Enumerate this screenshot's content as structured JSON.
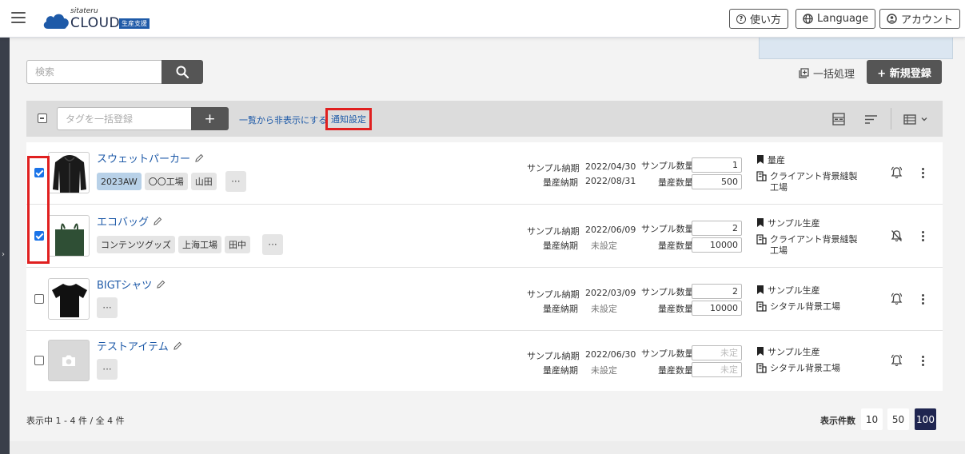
{
  "header": {
    "logo_sub": "sitateru",
    "logo_main": "CLOUD",
    "logo_badge": "生産支援",
    "help_label": "使い方",
    "language_label": "Language",
    "account_label": "アカウント"
  },
  "search": {
    "placeholder": "検索"
  },
  "actions": {
    "bulk_label": "一括処理",
    "new_label": "+ 新規登録"
  },
  "toolbar": {
    "tag_placeholder": "タグを一括登録",
    "tag_add": "+",
    "hide_label": "一覧から非表示にする",
    "notify_label": "通知設定"
  },
  "labels": {
    "sample_due": "サンプル納期",
    "mass_due": "量産納期",
    "sample_qty": "サンプル数量",
    "mass_qty": "量産数量"
  },
  "items": [
    {
      "name": "スウェットパーカー",
      "checked": true,
      "tags": [
        "2023AW",
        "〇〇工場",
        "山田"
      ],
      "sample_date": "2022/04/30",
      "mass_date": "2022/08/31",
      "sample_qty": "1",
      "mass_qty": "500",
      "status": "量産",
      "factory": "クライアント背景縫製工場",
      "bell": "on",
      "image": "hoodie"
    },
    {
      "name": "エコバッグ",
      "checked": true,
      "tags": [
        "コンテンツグッズ",
        "上海工場",
        "田中"
      ],
      "sample_date": "2022/06/09",
      "mass_date": "未設定",
      "sample_qty": "2",
      "mass_qty": "10000",
      "status": "サンプル生産",
      "factory": "クライアント背景縫製工場",
      "bell": "off",
      "image": "bag"
    },
    {
      "name": "BIGTシャツ",
      "checked": false,
      "tags": [],
      "sample_date": "2022/03/09",
      "mass_date": "未設定",
      "sample_qty": "2",
      "mass_qty": "10000",
      "status": "サンプル生産",
      "factory": "シタテル背景工場",
      "bell": "on",
      "image": "tshirt"
    },
    {
      "name": "テストアイテム",
      "checked": false,
      "tags": [],
      "sample_date": "2022/06/30",
      "mass_date": "未設定",
      "sample_qty": "未定",
      "mass_qty": "未定",
      "status": "サンプル生産",
      "factory": "シタテル背景工場",
      "bell": "on",
      "image": "none"
    }
  ],
  "footer": {
    "count_text": "表示中 1 - 4 件 / 全 4 件",
    "per_page_label": "表示件数",
    "per_page_options": [
      "10",
      "50",
      "100"
    ],
    "per_page_selected": "100"
  },
  "colors": {
    "link": "#1e5aa8",
    "highlight": "#e02020",
    "dark_button": "#555555",
    "active_page": "#1f2550"
  }
}
